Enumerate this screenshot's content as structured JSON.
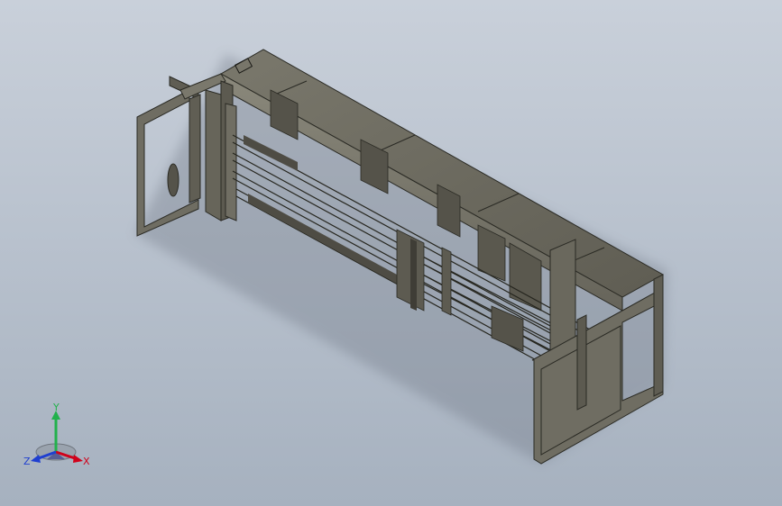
{
  "viewport": {
    "background_top": "#c9d0da",
    "background_bottom": "#a6b1bf",
    "model_color": "#6f6d62",
    "model_edge_color": "#2a2a24"
  },
  "triad": {
    "x_label": "X",
    "y_label": "Y",
    "z_label": "Z",
    "x_color": "#d0021b",
    "y_color": "#22b14c",
    "z_color": "#1f3fd0",
    "icon": "coordinate-triad-icon"
  }
}
